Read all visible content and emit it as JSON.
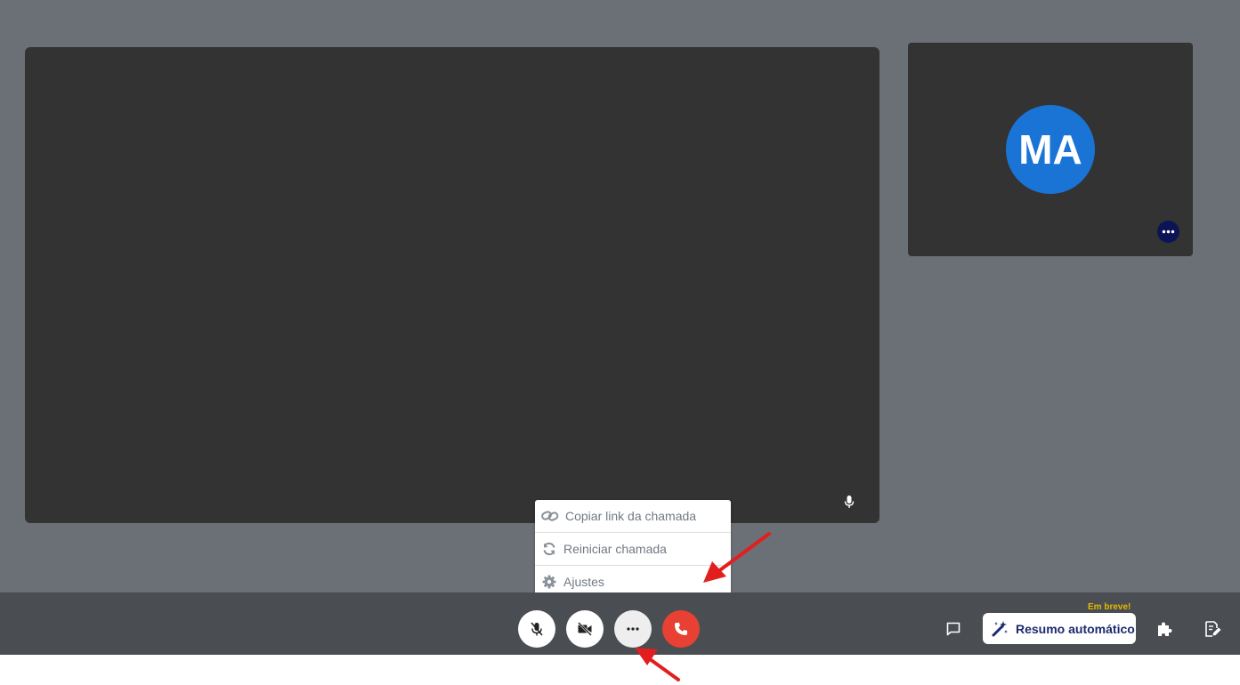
{
  "participant": {
    "initials": "MA",
    "avatar_color": "#1a74d6"
  },
  "menu": {
    "items": [
      {
        "label": "Copiar link da chamada",
        "icon": "link-icon"
      },
      {
        "label": "Reiniciar chamada",
        "icon": "refresh-icon"
      },
      {
        "label": "Ajustes",
        "icon": "gear-icon"
      }
    ]
  },
  "toolbar": {
    "controls": [
      {
        "name": "mute-microphone",
        "icon": "mic-off-icon"
      },
      {
        "name": "toggle-camera",
        "icon": "camera-off-icon"
      },
      {
        "name": "more-options",
        "icon": "more-icon"
      },
      {
        "name": "hang-up",
        "icon": "phone-icon"
      }
    ],
    "summary_label": "Resumo automático",
    "soon_badge": "Em breve!",
    "hangup_color": "#e84133"
  },
  "annotations": {
    "arrow_color": "#e31e1e"
  }
}
